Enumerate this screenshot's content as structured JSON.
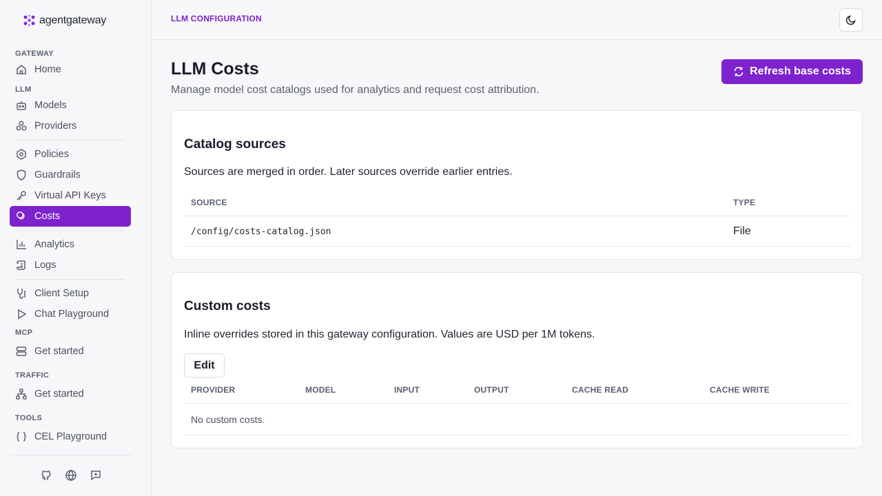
{
  "brand": {
    "name": "agentgateway"
  },
  "sidebar": {
    "sections": {
      "gateway": "GATEWAY",
      "llm": "LLM",
      "mcp": "MCP",
      "traffic": "TRAFFIC",
      "tools": "TOOLS"
    },
    "items": {
      "home": "Home",
      "models": "Models",
      "providers": "Providers",
      "policies": "Policies",
      "guardrails": "Guardrails",
      "virtual_api_keys": "Virtual API Keys",
      "costs": "Costs",
      "analytics": "Analytics",
      "logs": "Logs",
      "client_setup": "Client Setup",
      "chat_playground": "Chat Playground",
      "mcp_get_started": "Get started",
      "traffic_get_started": "Get started",
      "cel_playground": "CEL Playground"
    },
    "active_item": "Costs",
    "footer_icons": [
      "github-icon",
      "globe-icon",
      "feedback-icon"
    ]
  },
  "header": {
    "breadcrumb": "LLM CONFIGURATION",
    "theme_toggle_icon": "moon-icon"
  },
  "main": {
    "title": "LLM Costs",
    "subtitle": "Manage model cost catalogs used for analytics and request cost attribution.",
    "refresh_button": "Refresh base costs",
    "catalog": {
      "title": "Catalog sources",
      "description": "Sources are merged in order. Later sources override earlier entries.",
      "columns": {
        "source": "SOURCE",
        "type": "TYPE"
      },
      "rows": [
        {
          "source": "/config/costs-catalog.json",
          "type": "File"
        }
      ]
    },
    "custom": {
      "title": "Custom costs",
      "description": "Inline overrides stored in this gateway configuration. Values are USD per 1M tokens.",
      "edit_button": "Edit",
      "columns": {
        "provider": "PROVIDER",
        "model": "MODEL",
        "input": "INPUT",
        "output": "OUTPUT",
        "cache_read": "CACHE READ",
        "cache_write": "CACHE WRITE"
      },
      "empty_text": "No custom costs."
    }
  },
  "colors": {
    "accent": "#7e22ce",
    "background": "#f7f7f9",
    "card": "#ffffff",
    "border": "#e4e5ea"
  }
}
